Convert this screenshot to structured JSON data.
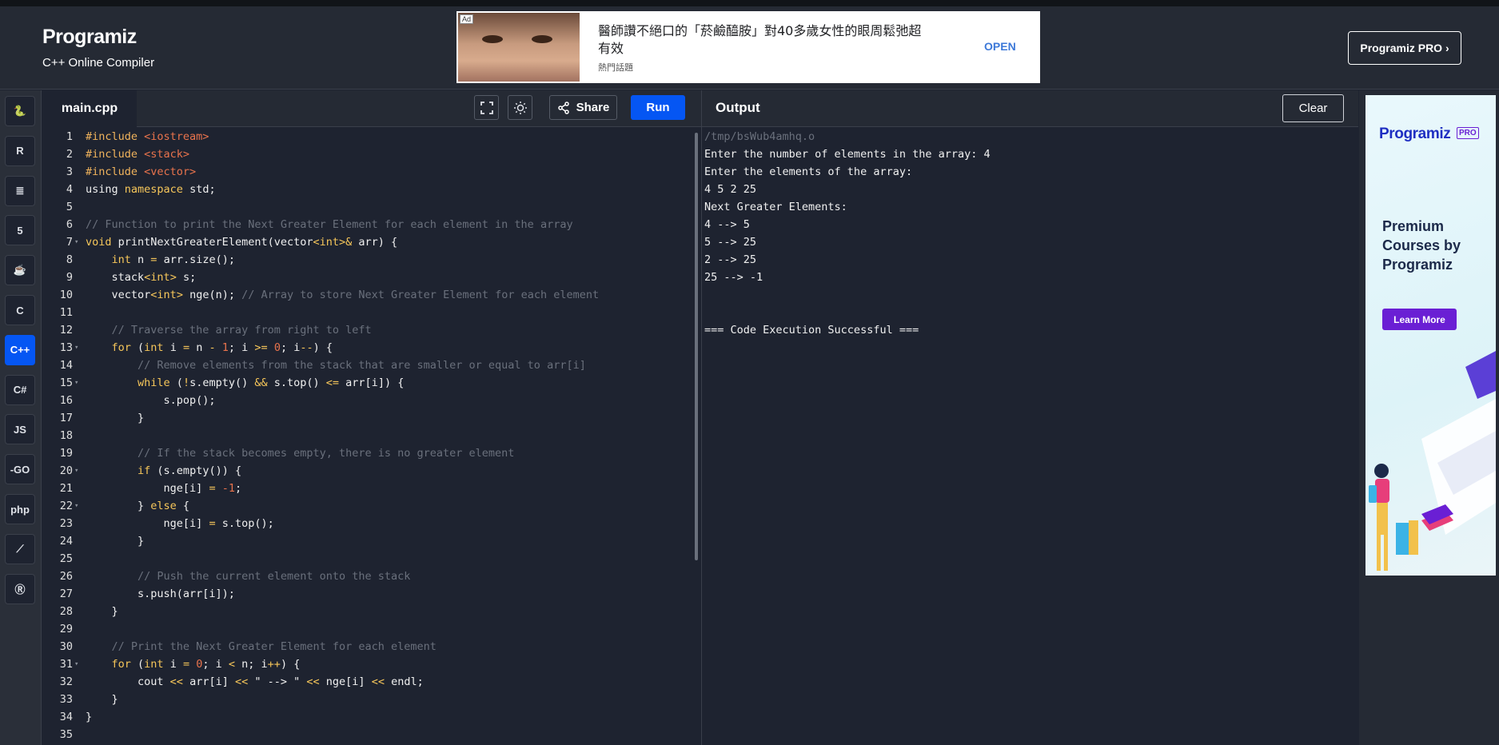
{
  "header": {
    "logo": "Programiz",
    "subtitle": "C++ Online Compiler",
    "pro_button": "Programiz PRO ›"
  },
  "ad": {
    "badge": "Ad",
    "text": "醫師讚不絕口的「菸鹼醯胺」對40多歲女性的眼周鬆弛超有效",
    "source": "熱門話題",
    "open_label": "OPEN"
  },
  "sidebar": {
    "languages": [
      {
        "name": "python",
        "glyph": "🐍"
      },
      {
        "name": "r",
        "glyph": "R"
      },
      {
        "name": "sql",
        "glyph": "≣"
      },
      {
        "name": "html",
        "glyph": "5"
      },
      {
        "name": "java",
        "glyph": "☕"
      },
      {
        "name": "c",
        "glyph": "C"
      },
      {
        "name": "cpp",
        "glyph": "C++",
        "active": true
      },
      {
        "name": "csharp",
        "glyph": "C#"
      },
      {
        "name": "javascript",
        "glyph": "JS"
      },
      {
        "name": "go",
        "glyph": "-GO"
      },
      {
        "name": "php",
        "glyph": "php"
      },
      {
        "name": "swift",
        "glyph": "⟋"
      },
      {
        "name": "rust",
        "glyph": "Ⓡ"
      }
    ]
  },
  "editor": {
    "tab_label": "main.cpp",
    "share_label": "Share",
    "run_label": "Run",
    "lines": [
      [
        {
          "t": "#include ",
          "c": "pp"
        },
        {
          "t": "<iostream>",
          "c": "str"
        }
      ],
      [
        {
          "t": "#include ",
          "c": "pp"
        },
        {
          "t": "<stack>",
          "c": "str"
        }
      ],
      [
        {
          "t": "#include ",
          "c": "pp"
        },
        {
          "t": "<vector>",
          "c": "str"
        }
      ],
      [
        {
          "t": "using ",
          "c": ""
        },
        {
          "t": "namespace",
          "c": "kw"
        },
        {
          "t": " std;",
          "c": ""
        }
      ],
      [],
      [
        {
          "t": "// Function to print the Next Greater Element for each element in the array",
          "c": "cm"
        }
      ],
      [
        {
          "t": "void",
          "c": "kw"
        },
        {
          "t": " printNextGreaterElement(vector",
          "c": ""
        },
        {
          "t": "<",
          "c": "op"
        },
        {
          "t": "int",
          "c": "kw"
        },
        {
          "t": ">&",
          "c": "op"
        },
        {
          "t": " arr) {",
          "c": ""
        }
      ],
      [
        {
          "t": "    ",
          "c": ""
        },
        {
          "t": "int",
          "c": "kw"
        },
        {
          "t": " n ",
          "c": ""
        },
        {
          "t": "=",
          "c": "op"
        },
        {
          "t": " arr.size();",
          "c": ""
        }
      ],
      [
        {
          "t": "    stack",
          "c": ""
        },
        {
          "t": "<",
          "c": "op"
        },
        {
          "t": "int",
          "c": "kw"
        },
        {
          "t": ">",
          "c": "op"
        },
        {
          "t": " s;",
          "c": ""
        }
      ],
      [
        {
          "t": "    vector",
          "c": ""
        },
        {
          "t": "<",
          "c": "op"
        },
        {
          "t": "int",
          "c": "kw"
        },
        {
          "t": ">",
          "c": "op"
        },
        {
          "t": " nge(n); ",
          "c": ""
        },
        {
          "t": "// Array to store Next Greater Element for each element",
          "c": "cm"
        }
      ],
      [],
      [
        {
          "t": "    // Traverse the array from right to left",
          "c": "cm"
        }
      ],
      [
        {
          "t": "    ",
          "c": ""
        },
        {
          "t": "for",
          "c": "kw"
        },
        {
          "t": " (",
          "c": ""
        },
        {
          "t": "int",
          "c": "kw"
        },
        {
          "t": " i ",
          "c": ""
        },
        {
          "t": "=",
          "c": "op"
        },
        {
          "t": " n ",
          "c": ""
        },
        {
          "t": "-",
          "c": "op"
        },
        {
          "t": " ",
          "c": ""
        },
        {
          "t": "1",
          "c": "num"
        },
        {
          "t": "; i ",
          "c": ""
        },
        {
          "t": ">=",
          "c": "op"
        },
        {
          "t": " ",
          "c": ""
        },
        {
          "t": "0",
          "c": "num"
        },
        {
          "t": "; i",
          "c": ""
        },
        {
          "t": "--",
          "c": "op"
        },
        {
          "t": ") {",
          "c": ""
        }
      ],
      [
        {
          "t": "        // Remove elements from the stack that are smaller or equal to arr[i]",
          "c": "cm"
        }
      ],
      [
        {
          "t": "        ",
          "c": ""
        },
        {
          "t": "while",
          "c": "kw"
        },
        {
          "t": " (",
          "c": ""
        },
        {
          "t": "!",
          "c": "op"
        },
        {
          "t": "s.empty() ",
          "c": ""
        },
        {
          "t": "&&",
          "c": "op"
        },
        {
          "t": " s.top() ",
          "c": ""
        },
        {
          "t": "<=",
          "c": "op"
        },
        {
          "t": " arr[i]) {",
          "c": ""
        }
      ],
      [
        {
          "t": "            s.pop();",
          "c": ""
        }
      ],
      [
        {
          "t": "        }",
          "c": ""
        }
      ],
      [],
      [
        {
          "t": "        // If the stack becomes empty, there is no greater element",
          "c": "cm"
        }
      ],
      [
        {
          "t": "        ",
          "c": ""
        },
        {
          "t": "if",
          "c": "kw"
        },
        {
          "t": " (s.empty()) {",
          "c": ""
        }
      ],
      [
        {
          "t": "            nge[i] ",
          "c": ""
        },
        {
          "t": "=",
          "c": "op"
        },
        {
          "t": " ",
          "c": ""
        },
        {
          "t": "-1",
          "c": "num"
        },
        {
          "t": ";",
          "c": ""
        }
      ],
      [
        {
          "t": "        } ",
          "c": ""
        },
        {
          "t": "else",
          "c": "kw"
        },
        {
          "t": " {",
          "c": ""
        }
      ],
      [
        {
          "t": "            nge[i] ",
          "c": ""
        },
        {
          "t": "=",
          "c": "op"
        },
        {
          "t": " s.top();",
          "c": ""
        }
      ],
      [
        {
          "t": "        }",
          "c": ""
        }
      ],
      [],
      [
        {
          "t": "        // Push the current element onto the stack",
          "c": "cm"
        }
      ],
      [
        {
          "t": "        s.push(arr[i]);",
          "c": ""
        }
      ],
      [
        {
          "t": "    }",
          "c": ""
        }
      ],
      [],
      [
        {
          "t": "    // Print the Next Greater Element for each element",
          "c": "cm"
        }
      ],
      [
        {
          "t": "    ",
          "c": ""
        },
        {
          "t": "for",
          "c": "kw"
        },
        {
          "t": " (",
          "c": ""
        },
        {
          "t": "int",
          "c": "kw"
        },
        {
          "t": " i ",
          "c": ""
        },
        {
          "t": "=",
          "c": "op"
        },
        {
          "t": " ",
          "c": ""
        },
        {
          "t": "0",
          "c": "num"
        },
        {
          "t": "; i ",
          "c": ""
        },
        {
          "t": "<",
          "c": "op"
        },
        {
          "t": " n; i",
          "c": ""
        },
        {
          "t": "++",
          "c": "op"
        },
        {
          "t": ") {",
          "c": ""
        }
      ],
      [
        {
          "t": "        cout ",
          "c": ""
        },
        {
          "t": "<<",
          "c": "op"
        },
        {
          "t": " arr[i] ",
          "c": ""
        },
        {
          "t": "<<",
          "c": "op"
        },
        {
          "t": " \" --> \" ",
          "c": ""
        },
        {
          "t": "<<",
          "c": "op"
        },
        {
          "t": " nge[i] ",
          "c": ""
        },
        {
          "t": "<<",
          "c": "op"
        },
        {
          "t": " endl;",
          "c": ""
        }
      ],
      [
        {
          "t": "    }",
          "c": ""
        }
      ],
      [
        {
          "t": "}",
          "c": ""
        }
      ],
      []
    ],
    "fold_lines": [
      7,
      13,
      15,
      20,
      22,
      31
    ]
  },
  "output": {
    "title": "Output",
    "clear_label": "Clear",
    "lines": [
      "/tmp/bsWub4amhq.o",
      "Enter the number of elements in the array: 4",
      "Enter the elements of the array:",
      "4 5 2 25",
      "Next Greater Elements:",
      "4 --> 5",
      "5 --> 25",
      "2 --> 25",
      "25 --> -1",
      "",
      "",
      "=== Code Execution Successful ==="
    ]
  },
  "promo": {
    "logo": "Programiz",
    "pro_badge": "PRO",
    "heading": "Premium Courses by Programiz",
    "button": "Learn More"
  },
  "colors": {
    "accent": "#0556f3",
    "promo_purple": "#6a1fd4",
    "keyword": "#f7c75a",
    "string": "#e9734c",
    "comment": "#6a707c"
  }
}
